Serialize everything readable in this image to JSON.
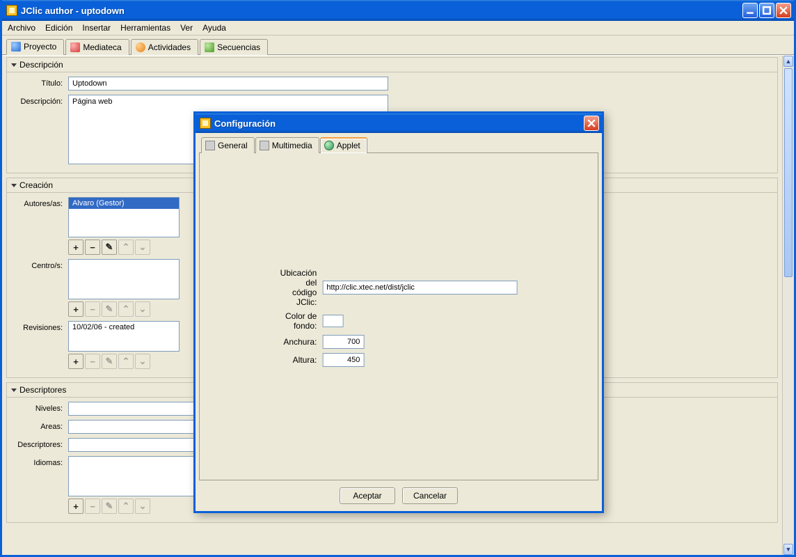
{
  "window": {
    "title": "JClic author - uptodown"
  },
  "menu": {
    "archivo": "Archivo",
    "edicion": "Edición",
    "insertar": "Insertar",
    "herramientas": "Herramientas",
    "ver": "Ver",
    "ayuda": "Ayuda"
  },
  "mainTabs": {
    "proyecto": "Proyecto",
    "mediateca": "Mediateca",
    "actividades": "Actividades",
    "secuencias": "Secuencias"
  },
  "sections": {
    "descripcion": {
      "header": "Descripción",
      "titulo_label": "Título:",
      "titulo_value": "Uptodown",
      "descripcion_label": "Descripción:",
      "descripcion_value": "Página web"
    },
    "creacion": {
      "header": "Creación",
      "autores_label": "Autores/as:",
      "autores_item": "Alvaro (Gestor)",
      "centros_label": "Centro/s:",
      "revisiones_label": "Revisiones:",
      "revisiones_item": "10/02/06 - created"
    },
    "descriptores": {
      "header": "Descriptores",
      "niveles_label": "Niveles:",
      "areas_label": "Areas:",
      "descriptores_label": "Descriptores:",
      "idiomas_label": "Idiomas:"
    }
  },
  "buttons": {
    "plus": "+",
    "minus": "−"
  },
  "dialog": {
    "title": "Configuración",
    "tabs": {
      "general": "General",
      "multimedia": "Multimedia",
      "applet": "Applet"
    },
    "fields": {
      "ubicacion_label": "Ubicación del código JClic:",
      "ubicacion_value": "http://clic.xtec.net/dist/jclic",
      "color_label": "Color de fondo:",
      "anchura_label": "Anchura:",
      "anchura_value": "700",
      "altura_label": "Altura:",
      "altura_value": "450"
    },
    "ok": "Aceptar",
    "cancel": "Cancelar"
  }
}
